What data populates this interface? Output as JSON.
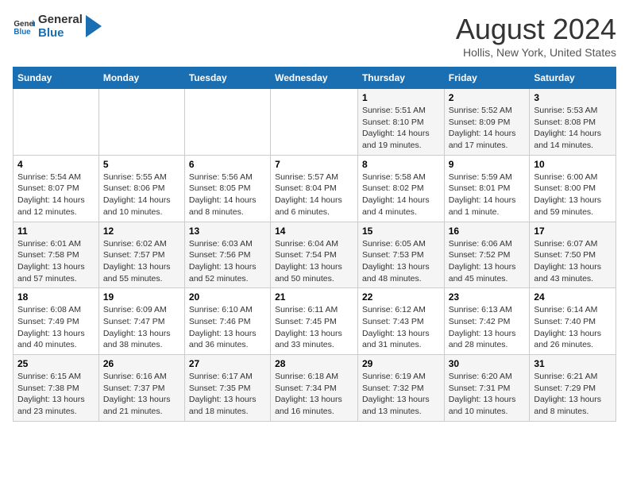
{
  "header": {
    "logo_line1": "General",
    "logo_line2": "Blue",
    "main_title": "August 2024",
    "subtitle": "Hollis, New York, United States"
  },
  "weekdays": [
    "Sunday",
    "Monday",
    "Tuesday",
    "Wednesday",
    "Thursday",
    "Friday",
    "Saturday"
  ],
  "weeks": [
    [
      {
        "day": "",
        "info": ""
      },
      {
        "day": "",
        "info": ""
      },
      {
        "day": "",
        "info": ""
      },
      {
        "day": "",
        "info": ""
      },
      {
        "day": "1",
        "info": "Sunrise: 5:51 AM\nSunset: 8:10 PM\nDaylight: 14 hours\nand 19 minutes."
      },
      {
        "day": "2",
        "info": "Sunrise: 5:52 AM\nSunset: 8:09 PM\nDaylight: 14 hours\nand 17 minutes."
      },
      {
        "day": "3",
        "info": "Sunrise: 5:53 AM\nSunset: 8:08 PM\nDaylight: 14 hours\nand 14 minutes."
      }
    ],
    [
      {
        "day": "4",
        "info": "Sunrise: 5:54 AM\nSunset: 8:07 PM\nDaylight: 14 hours\nand 12 minutes."
      },
      {
        "day": "5",
        "info": "Sunrise: 5:55 AM\nSunset: 8:06 PM\nDaylight: 14 hours\nand 10 minutes."
      },
      {
        "day": "6",
        "info": "Sunrise: 5:56 AM\nSunset: 8:05 PM\nDaylight: 14 hours\nand 8 minutes."
      },
      {
        "day": "7",
        "info": "Sunrise: 5:57 AM\nSunset: 8:04 PM\nDaylight: 14 hours\nand 6 minutes."
      },
      {
        "day": "8",
        "info": "Sunrise: 5:58 AM\nSunset: 8:02 PM\nDaylight: 14 hours\nand 4 minutes."
      },
      {
        "day": "9",
        "info": "Sunrise: 5:59 AM\nSunset: 8:01 PM\nDaylight: 14 hours\nand 1 minute."
      },
      {
        "day": "10",
        "info": "Sunrise: 6:00 AM\nSunset: 8:00 PM\nDaylight: 13 hours\nand 59 minutes."
      }
    ],
    [
      {
        "day": "11",
        "info": "Sunrise: 6:01 AM\nSunset: 7:58 PM\nDaylight: 13 hours\nand 57 minutes."
      },
      {
        "day": "12",
        "info": "Sunrise: 6:02 AM\nSunset: 7:57 PM\nDaylight: 13 hours\nand 55 minutes."
      },
      {
        "day": "13",
        "info": "Sunrise: 6:03 AM\nSunset: 7:56 PM\nDaylight: 13 hours\nand 52 minutes."
      },
      {
        "day": "14",
        "info": "Sunrise: 6:04 AM\nSunset: 7:54 PM\nDaylight: 13 hours\nand 50 minutes."
      },
      {
        "day": "15",
        "info": "Sunrise: 6:05 AM\nSunset: 7:53 PM\nDaylight: 13 hours\nand 48 minutes."
      },
      {
        "day": "16",
        "info": "Sunrise: 6:06 AM\nSunset: 7:52 PM\nDaylight: 13 hours\nand 45 minutes."
      },
      {
        "day": "17",
        "info": "Sunrise: 6:07 AM\nSunset: 7:50 PM\nDaylight: 13 hours\nand 43 minutes."
      }
    ],
    [
      {
        "day": "18",
        "info": "Sunrise: 6:08 AM\nSunset: 7:49 PM\nDaylight: 13 hours\nand 40 minutes."
      },
      {
        "day": "19",
        "info": "Sunrise: 6:09 AM\nSunset: 7:47 PM\nDaylight: 13 hours\nand 38 minutes."
      },
      {
        "day": "20",
        "info": "Sunrise: 6:10 AM\nSunset: 7:46 PM\nDaylight: 13 hours\nand 36 minutes."
      },
      {
        "day": "21",
        "info": "Sunrise: 6:11 AM\nSunset: 7:45 PM\nDaylight: 13 hours\nand 33 minutes."
      },
      {
        "day": "22",
        "info": "Sunrise: 6:12 AM\nSunset: 7:43 PM\nDaylight: 13 hours\nand 31 minutes."
      },
      {
        "day": "23",
        "info": "Sunrise: 6:13 AM\nSunset: 7:42 PM\nDaylight: 13 hours\nand 28 minutes."
      },
      {
        "day": "24",
        "info": "Sunrise: 6:14 AM\nSunset: 7:40 PM\nDaylight: 13 hours\nand 26 minutes."
      }
    ],
    [
      {
        "day": "25",
        "info": "Sunrise: 6:15 AM\nSunset: 7:38 PM\nDaylight: 13 hours\nand 23 minutes."
      },
      {
        "day": "26",
        "info": "Sunrise: 6:16 AM\nSunset: 7:37 PM\nDaylight: 13 hours\nand 21 minutes."
      },
      {
        "day": "27",
        "info": "Sunrise: 6:17 AM\nSunset: 7:35 PM\nDaylight: 13 hours\nand 18 minutes."
      },
      {
        "day": "28",
        "info": "Sunrise: 6:18 AM\nSunset: 7:34 PM\nDaylight: 13 hours\nand 16 minutes."
      },
      {
        "day": "29",
        "info": "Sunrise: 6:19 AM\nSunset: 7:32 PM\nDaylight: 13 hours\nand 13 minutes."
      },
      {
        "day": "30",
        "info": "Sunrise: 6:20 AM\nSunset: 7:31 PM\nDaylight: 13 hours\nand 10 minutes."
      },
      {
        "day": "31",
        "info": "Sunrise: 6:21 AM\nSunset: 7:29 PM\nDaylight: 13 hours\nand 8 minutes."
      }
    ]
  ]
}
